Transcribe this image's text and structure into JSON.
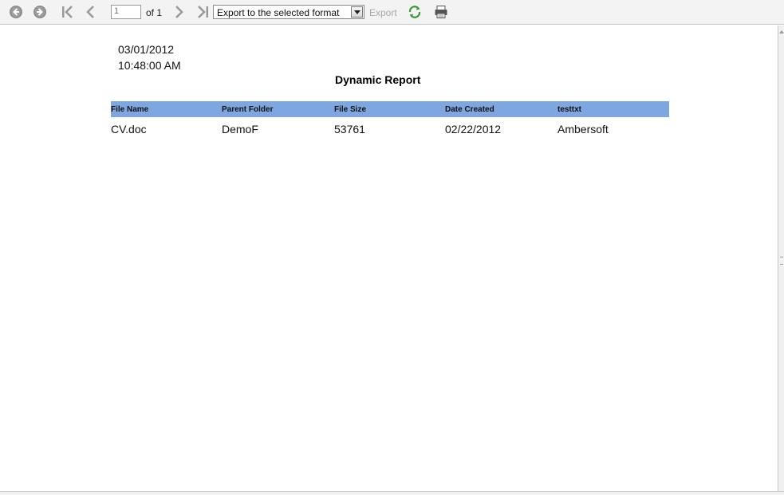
{
  "toolbar": {
    "page_input_value": "1",
    "page_of_text": "of 1",
    "export_format_selected": "Export to the selected format",
    "export_label": "Export",
    "icons": {
      "back": "circle-arrow-left-icon",
      "forward": "circle-arrow-right-icon",
      "first": "first-page-icon",
      "previous": "previous-page-icon",
      "next": "next-page-icon",
      "last": "last-page-icon",
      "dropdown": "chevron-down-icon",
      "refresh": "refresh-icon",
      "print": "printer-icon"
    }
  },
  "report": {
    "date": "03/01/2012",
    "time": "10:48:00 AM",
    "title": "Dynamic Report",
    "header_color": "#7ea6e0",
    "columns": [
      "File Name",
      "Parent Folder",
      "File Size",
      "Date Created",
      "testtxt"
    ],
    "rows": [
      [
        "CV.doc",
        "DemoF",
        "53761",
        "02/22/2012",
        "Ambersoft"
      ]
    ]
  }
}
